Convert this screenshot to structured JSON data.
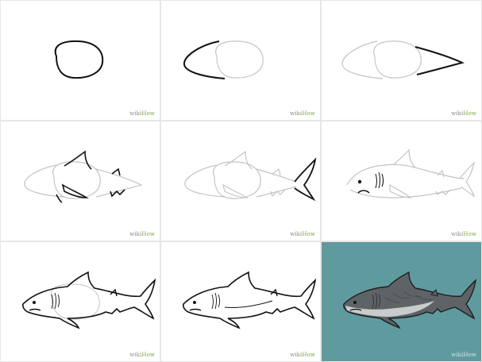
{
  "watermark": {
    "brand_a": "wiki",
    "brand_b": "How"
  },
  "colors": {
    "pencil_guide": "#c4c4c4",
    "ink": "#111111",
    "panel_bg": "#ffffff",
    "final_bg": "#5f9a9e",
    "shark_body": "#5e6466",
    "shark_belly": "#c6cdcc"
  },
  "steps": [
    {
      "name": "step-1-circle"
    },
    {
      "name": "step-2-snout"
    },
    {
      "name": "step-3-tail-taper"
    },
    {
      "name": "step-4-fins"
    },
    {
      "name": "step-5-tail-fin"
    },
    {
      "name": "step-6-face-gills"
    },
    {
      "name": "step-7-outline"
    },
    {
      "name": "step-8-clean-lines"
    },
    {
      "name": "step-9-colored"
    }
  ]
}
